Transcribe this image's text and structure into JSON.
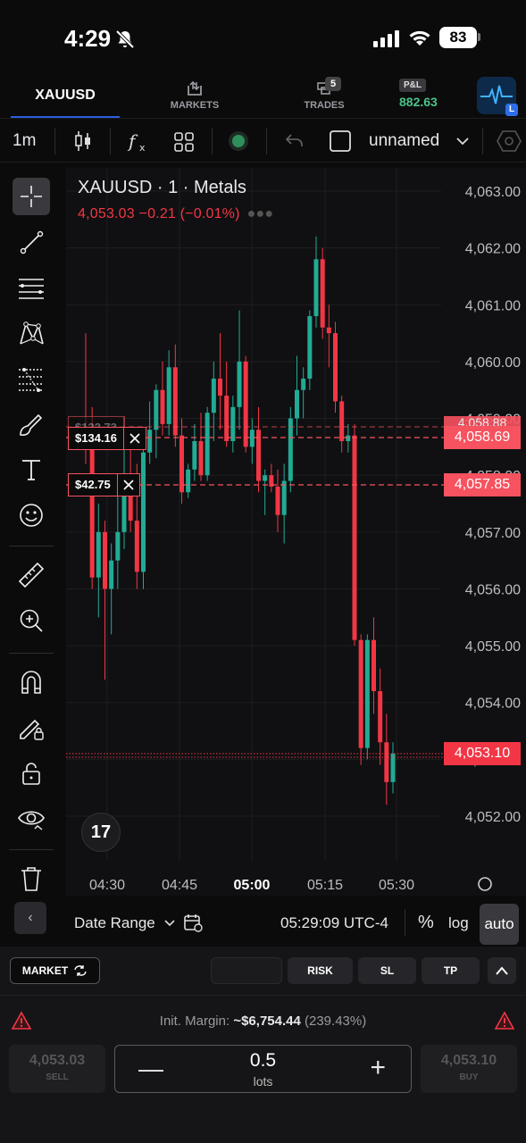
{
  "status_bar": {
    "time": "4:29",
    "battery": "83",
    "icons": [
      "bell-slash-icon",
      "signal-icon",
      "wifi-icon",
      "battery-icon"
    ]
  },
  "nav": {
    "symbol": "XAUUSD",
    "markets_label": "MARKETS",
    "trades_label": "TRADES",
    "trades_count": "5",
    "pnl_badge": "P&L",
    "pnl_value": "882.63",
    "profile_badge": "L"
  },
  "toolbar": {
    "interval": "1m",
    "layout_name": "unnamed",
    "icons": [
      "candles-icon",
      "indicators-icon",
      "layouts-icon",
      "record-icon",
      "undo-icon",
      "square-icon",
      "chevron-down-icon",
      "settings-hex-icon"
    ]
  },
  "left_tools": [
    "crosshair-icon",
    "trend-line-icon",
    "horizontal-lines-icon",
    "pattern-icon",
    "fib-icon",
    "brush-icon",
    "text-icon",
    "emoji-icon",
    "ruler-icon",
    "zoom-in-icon",
    "magnet-icon",
    "lock-drawings-icon",
    "unlock-icon",
    "eye-icon",
    "trash-icon"
  ],
  "chart": {
    "title": "XAUUSD · 1 · Metals",
    "quote": "4,053.03  −0.21 (−0.01%)",
    "positions": [
      {
        "amount": "$134.16",
        "price_label": "4,058.69"
      },
      {
        "amount": "$42.75",
        "price_label": "4,057.85"
      }
    ],
    "partial_price_label": "4,058.88",
    "current_price_label": "4,053.10",
    "logo_text": "17"
  },
  "chart_data": {
    "type": "candlestick",
    "title": "XAUUSD · 1 · Metals",
    "y_ticks": [
      "4,063.00",
      "4,062.00",
      "4,061.00",
      "4,060.00",
      "4,059.00",
      "4,058.00",
      "4,057.00",
      "4,056.00",
      "4,055.00",
      "4,054.00",
      "4,053.00",
      "4,052.00"
    ],
    "x_ticks": [
      "04:30",
      "04:45",
      "05:00",
      "05:15",
      "05:30"
    ],
    "ylim": [
      4051.7,
      4063.2
    ],
    "x_range": [
      "04:25",
      "05:35"
    ],
    "up_color": "#22ab94",
    "down_color": "#f23645",
    "candles": [
      {
        "o": 4058.8,
        "h": 4060.5,
        "l": 4058.2,
        "c": 4058.5
      },
      {
        "o": 4058.5,
        "h": 4059.2,
        "l": 4056.0,
        "c": 4056.2
      },
      {
        "o": 4056.2,
        "h": 4057.5,
        "l": 4055.5,
        "c": 4057.0
      },
      {
        "o": 4057.0,
        "h": 4057.2,
        "l": 4054.4,
        "c": 4056.0
      },
      {
        "o": 4056.0,
        "h": 4056.8,
        "l": 4055.2,
        "c": 4056.5
      },
      {
        "o": 4056.5,
        "h": 4058.0,
        "l": 4056.0,
        "c": 4057.0
      },
      {
        "o": 4057.0,
        "h": 4058.5,
        "l": 4056.7,
        "c": 4057.9
      },
      {
        "o": 4057.9,
        "h": 4058.8,
        "l": 4057.0,
        "c": 4057.2
      },
      {
        "o": 4057.2,
        "h": 4058.2,
        "l": 4056.0,
        "c": 4056.3
      },
      {
        "o": 4056.3,
        "h": 4058.5,
        "l": 4056.0,
        "c": 4058.4
      },
      {
        "o": 4058.4,
        "h": 4059.3,
        "l": 4058.2,
        "c": 4058.8
      },
      {
        "o": 4058.8,
        "h": 4059.6,
        "l": 4058.3,
        "c": 4059.5
      },
      {
        "o": 4059.5,
        "h": 4060.0,
        "l": 4058.7,
        "c": 4058.9
      },
      {
        "o": 4058.9,
        "h": 4060.2,
        "l": 4058.7,
        "c": 4059.9
      },
      {
        "o": 4059.9,
        "h": 4060.3,
        "l": 4058.5,
        "c": 4058.7
      },
      {
        "o": 4058.7,
        "h": 4059.0,
        "l": 4057.5,
        "c": 4057.7
      },
      {
        "o": 4057.7,
        "h": 4058.2,
        "l": 4057.6,
        "c": 4058.1
      },
      {
        "o": 4058.1,
        "h": 4058.9,
        "l": 4057.9,
        "c": 4058.6
      },
      {
        "o": 4058.6,
        "h": 4059.1,
        "l": 4057.9,
        "c": 4058.0
      },
      {
        "o": 4058.0,
        "h": 4059.2,
        "l": 4057.9,
        "c": 4059.1
      },
      {
        "o": 4059.1,
        "h": 4060.0,
        "l": 4058.6,
        "c": 4059.7
      },
      {
        "o": 4059.7,
        "h": 4060.5,
        "l": 4058.8,
        "c": 4059.4
      },
      {
        "o": 4059.4,
        "h": 4060.0,
        "l": 4058.5,
        "c": 4058.6
      },
      {
        "o": 4058.6,
        "h": 4059.4,
        "l": 4058.4,
        "c": 4059.2
      },
      {
        "o": 4059.2,
        "h": 4060.9,
        "l": 4058.8,
        "c": 4060.0
      },
      {
        "o": 4060.0,
        "h": 4060.1,
        "l": 4058.4,
        "c": 4058.5
      },
      {
        "o": 4058.5,
        "h": 4059.0,
        "l": 4058.2,
        "c": 4058.8
      },
      {
        "o": 4058.8,
        "h": 4059.2,
        "l": 4057.7,
        "c": 4057.9
      },
      {
        "o": 4057.9,
        "h": 4058.1,
        "l": 4057.3,
        "c": 4058.0
      },
      {
        "o": 4058.0,
        "h": 4058.2,
        "l": 4057.7,
        "c": 4057.8
      },
      {
        "o": 4057.8,
        "h": 4058.1,
        "l": 4057.0,
        "c": 4057.3
      },
      {
        "o": 4057.3,
        "h": 4058.2,
        "l": 4056.8,
        "c": 4057.9
      },
      {
        "o": 4057.9,
        "h": 4059.2,
        "l": 4057.7,
        "c": 4059.0
      },
      {
        "o": 4059.0,
        "h": 4060.1,
        "l": 4058.7,
        "c": 4059.5
      },
      {
        "o": 4059.5,
        "h": 4059.9,
        "l": 4059.0,
        "c": 4059.7
      },
      {
        "o": 4059.7,
        "h": 4060.9,
        "l": 4059.5,
        "c": 4060.8
      },
      {
        "o": 4060.8,
        "h": 4062.2,
        "l": 4060.6,
        "c": 4061.8
      },
      {
        "o": 4061.8,
        "h": 4062.0,
        "l": 4060.4,
        "c": 4060.6
      },
      {
        "o": 4060.6,
        "h": 4061.0,
        "l": 4059.9,
        "c": 4060.5
      },
      {
        "o": 4060.5,
        "h": 4060.7,
        "l": 4059.1,
        "c": 4059.3
      },
      {
        "o": 4059.3,
        "h": 4059.4,
        "l": 4058.4,
        "c": 4058.6
      },
      {
        "o": 4058.6,
        "h": 4058.9,
        "l": 4058.4,
        "c": 4058.7
      },
      {
        "o": 4058.7,
        "h": 4058.9,
        "l": 4055.0,
        "c": 4055.1
      },
      {
        "o": 4055.1,
        "h": 4055.2,
        "l": 4052.9,
        "c": 4053.2
      },
      {
        "o": 4053.2,
        "h": 4055.2,
        "l": 4053.0,
        "c": 4055.1
      },
      {
        "o": 4055.1,
        "h": 4055.5,
        "l": 4053.8,
        "c": 4054.2
      },
      {
        "o": 4054.2,
        "h": 4054.6,
        "l": 4052.9,
        "c": 4053.3
      },
      {
        "o": 4053.3,
        "h": 4053.8,
        "l": 4052.2,
        "c": 4052.6
      },
      {
        "o": 4052.6,
        "h": 4053.3,
        "l": 4052.4,
        "c": 4053.1
      }
    ]
  },
  "chart_bottom": {
    "date_range": "Date Range",
    "time": "05:29:09 UTC-4",
    "percent": "%",
    "log": "log",
    "auto": "auto"
  },
  "order": {
    "market": "MARKET",
    "risk": "RISK",
    "sl": "SL",
    "tp": "TP",
    "init_margin_label": "Init. Margin:",
    "init_margin_value": "~$6,754.44",
    "init_margin_pct": "(239.43%)",
    "sell_price": "4,053.03",
    "sell_label": "SELL",
    "lots_value": "0.5",
    "lots_label": "lots",
    "buy_price": "4,053.10",
    "buy_label": "BUY"
  }
}
